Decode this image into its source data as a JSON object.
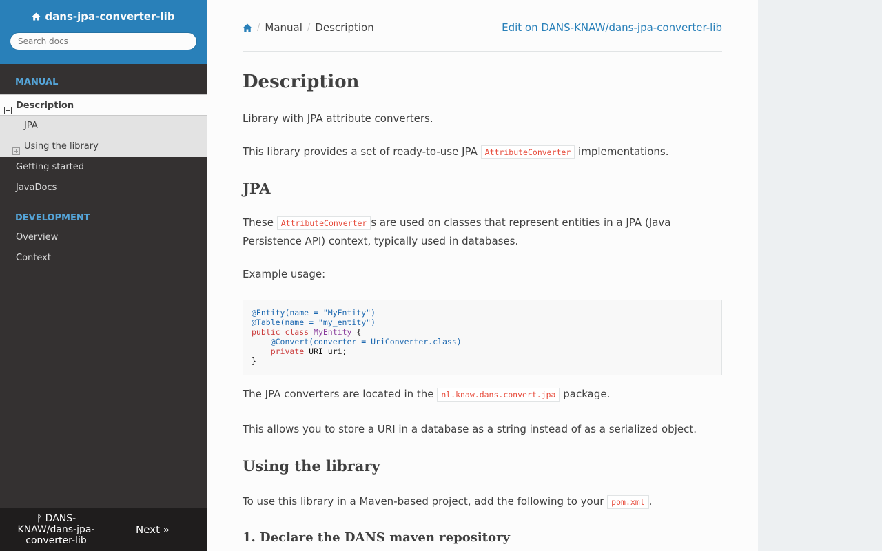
{
  "sidebar": {
    "project_title": "dans-jpa-converter-lib",
    "search_placeholder": "Search docs",
    "caption_manual": "MANUAL",
    "current_item": "Description",
    "sub_items": [
      {
        "label": "JPA"
      },
      {
        "label": "Using the library"
      }
    ],
    "manual_items": [
      {
        "label": "Getting started"
      },
      {
        "label": "JavaDocs"
      }
    ],
    "caption_development": "DEVELOPMENT",
    "development_items": [
      {
        "label": "Overview"
      },
      {
        "label": "Context"
      }
    ],
    "footer": {
      "repo_label": "DANS-KNAW/dans-jpa-converter-lib",
      "next_label": "Next »"
    }
  },
  "breadcrumbs": {
    "items": [
      "Manual",
      "Description"
    ],
    "edit_link": "Edit on DANS-KNAW/dans-jpa-converter-lib"
  },
  "doc": {
    "title": "Description",
    "p1": "Library with JPA attribute converters.",
    "p2_before": "This library provides a set of ready-to-use JPA ",
    "p2_code": "AttributeConverter",
    "p2_after": " implementations.",
    "h2_jpa": "JPA",
    "p3_before": "These ",
    "p3_code": "AttributeConverter",
    "p3_after": "s are used on classes that represent entities in a JPA (Java Persistence API) context, typically used in databases.",
    "p4": "Example usage:",
    "code_lines": {
      "l1": "@Entity(name = \"MyEntity\")",
      "l2": "@Table(name = \"my_entity\")",
      "l3_kw": "public class",
      "l3_cls": "MyEntity",
      "l3_rest": " {",
      "l4": "@Convert(converter = UriConverter.class)",
      "l5_kw": "private",
      "l5_rest": " URI uri;",
      "l6": "}"
    },
    "p5_before": "The JPA converters are located in the ",
    "p5_code": "nl.knaw.dans.convert.jpa",
    "p5_after": " package.",
    "p6": "This allows you to store a URI in a database as a string instead of as a serialized object.",
    "h2_using": "Using the library",
    "p7_before": "To use this library in a Maven-based project, add the following to your ",
    "p7_code": "pom.xml",
    "p7_after": ".",
    "h3_declare": "1. Declare the DANS maven repository"
  },
  "colors": {
    "accent": "#2980b9",
    "sidebar_bg": "#343131",
    "caption": "#55a5d9",
    "code_text": "#e74c3c"
  }
}
